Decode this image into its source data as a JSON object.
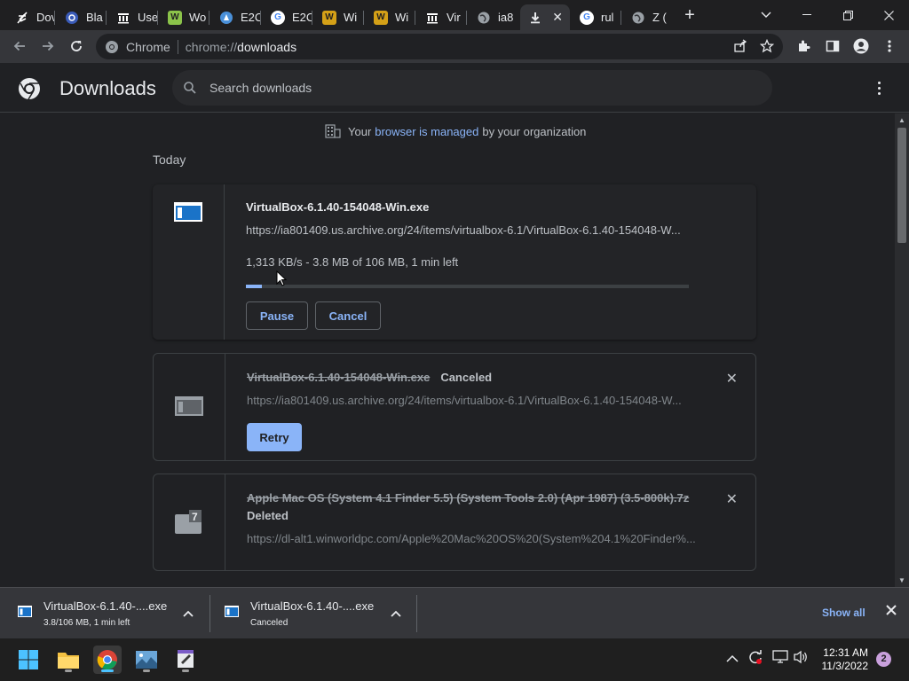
{
  "tabs": [
    {
      "label": "Dov",
      "icon": "feather-icon",
      "color": "#ffffff"
    },
    {
      "label": "Bla",
      "icon": "wheel-icon",
      "color": "#5b7fd6"
    },
    {
      "label": "Use",
      "icon": "archive-icon",
      "color": "#ffffff"
    },
    {
      "label": "Wo",
      "icon": "w-green-icon",
      "color": "#8bc34a"
    },
    {
      "label": "E2C",
      "icon": "e2c-icon",
      "color": "#4a90d9"
    },
    {
      "label": "E2C",
      "icon": "google-icon",
      "color": "#ffffff"
    },
    {
      "label": "Wi",
      "icon": "w-gold-icon",
      "color": "#d4a017"
    },
    {
      "label": "Wi",
      "icon": "w-gold-icon",
      "color": "#d4a017"
    },
    {
      "label": "Vir",
      "icon": "archive-icon",
      "color": "#ffffff"
    },
    {
      "label": "ia8",
      "icon": "globe-icon",
      "color": "#bdc1c6"
    },
    {
      "label": "",
      "icon": "download-icon",
      "color": "#e8eaed",
      "active": true
    },
    {
      "label": "rul",
      "icon": "google-icon",
      "color": "#ffffff"
    },
    {
      "label": "Z (",
      "icon": "globe-icon",
      "color": "#bdc1c6"
    }
  ],
  "omnibox": {
    "site": "Chrome",
    "url_scheme": "chrome://",
    "url_host": "downloads"
  },
  "page": {
    "title": "Downloads",
    "search_placeholder": "Search downloads",
    "managed_prefix": "Your",
    "managed_link": "browser is managed",
    "managed_suffix": "by your organization",
    "section": "Today"
  },
  "downloads": [
    {
      "name": "VirtualBox-6.1.40-154048-Win.exe",
      "url": "https://ia801409.us.archive.org/24/items/virtualbox-6.1/VirtualBox-6.1.40-154048-W...",
      "progress_text": "1,313 KB/s - 3.8 MB of 106 MB, 1 min left",
      "progress": 0.036,
      "buttons": [
        "Pause",
        "Cancel"
      ]
    },
    {
      "name": "VirtualBox-6.1.40-154048-Win.exe",
      "status": "Canceled",
      "url": "https://ia801409.us.archive.org/24/items/virtualbox-6.1/VirtualBox-6.1.40-154048-W...",
      "button": "Retry"
    },
    {
      "name": "Apple Mac OS (System 4.1 Finder 5.5) (System Tools 2.0) (Apr 1987) (3.5-800k).7z",
      "status": "Deleted",
      "url": "https://dl-alt1.winworldpc.com/Apple%20Mac%20OS%20(System%204.1%20Finder%..."
    }
  ],
  "shelf": {
    "items": [
      {
        "name": "VirtualBox-6.1.40-....exe",
        "sub": "3.8/106 MB, 1 min left"
      },
      {
        "name": "VirtualBox-6.1.40-....exe",
        "sub": "Canceled"
      }
    ],
    "show_all": "Show all"
  },
  "taskbar": {
    "time": "12:31 AM",
    "date": "11/3/2022",
    "notifications": "2"
  },
  "colors": {
    "accent": "#8ab4f8",
    "background": "#202124",
    "toolbar": "#35363a"
  }
}
